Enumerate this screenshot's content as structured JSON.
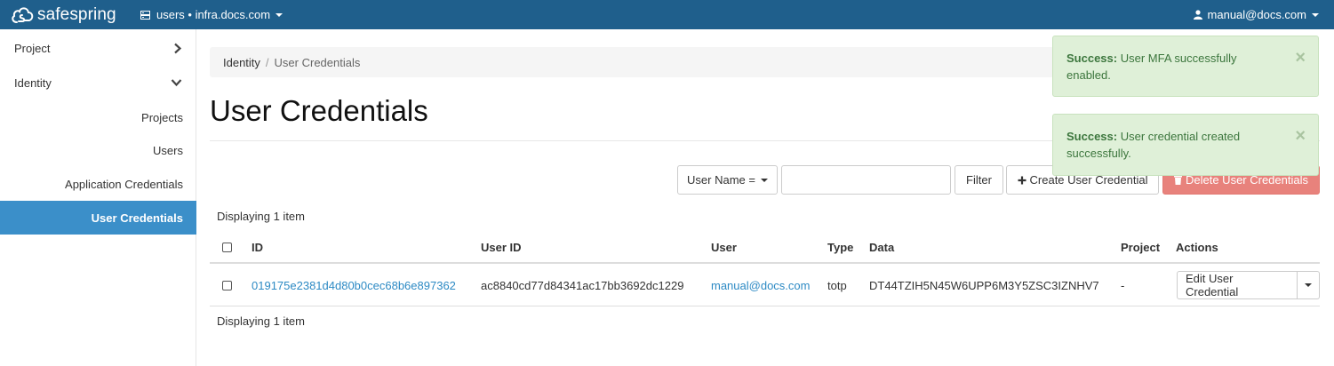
{
  "navbar": {
    "brand": "safespring",
    "project_label": "users • infra.docs.com",
    "user_label": "manual@docs.com",
    "colors": {
      "background": "#1f5f8c",
      "text": "#ffffff"
    }
  },
  "sidebar": {
    "sections": [
      {
        "label": "Project",
        "icon": "chevron-right-icon"
      },
      {
        "label": "Identity",
        "icon": "chevron-down-icon"
      }
    ],
    "items": [
      {
        "label": "Projects",
        "active": false
      },
      {
        "label": "Users",
        "active": false
      },
      {
        "label": "Application Credentials",
        "active": false
      },
      {
        "label": "User Credentials",
        "active": true
      }
    ],
    "active_color": "#3b8fc9"
  },
  "breadcrumb": {
    "root": "Identity",
    "separator": "/",
    "current": "User Credentials"
  },
  "page": {
    "title": "User Credentials"
  },
  "toolbar": {
    "filter_field": "User Name =",
    "filter_value": "",
    "filter_button": "Filter",
    "create_button": "Create User Credential",
    "delete_button": "Delete User Credentials",
    "danger_color": "#e8827c"
  },
  "table": {
    "count_top": "Displaying 1 item",
    "count_bottom": "Displaying 1 item",
    "columns": [
      "ID",
      "User ID",
      "User",
      "Type",
      "Data",
      "Project",
      "Actions"
    ],
    "rows": [
      {
        "id": "019175e2381d4d80b0cec68b6e897362",
        "user_id": "ac8840cd77d84341ac17bb3692dc1229",
        "user": "manual@docs.com",
        "type": "totp",
        "data": "DT44TZIH5N45W6UPP6M3Y5ZSC3IZNHV7",
        "project": "-",
        "action": "Edit User Credential"
      }
    ],
    "link_color": "#2d8ac4"
  },
  "alerts": [
    {
      "title": "Success:",
      "message": "User MFA successfully enabled.",
      "close": "×"
    },
    {
      "title": "Success:",
      "message": "User credential created successfully.",
      "close": "×"
    }
  ]
}
